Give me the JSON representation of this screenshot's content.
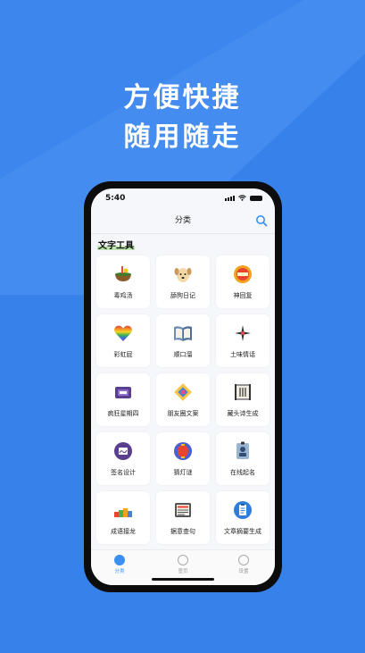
{
  "promo": {
    "line1": "方便快捷",
    "line2": "随用随走"
  },
  "status_bar": {
    "time": "5:40"
  },
  "nav": {
    "title": "分类",
    "search_icon": "search-icon"
  },
  "section": {
    "title": "文字工具"
  },
  "tools": [
    {
      "label": "毒鸡汤",
      "icon": "soup-bowl-icon"
    },
    {
      "label": "舔狗日记",
      "icon": "dog-icon"
    },
    {
      "label": "神回复",
      "icon": "wow-badge-icon"
    },
    {
      "label": "彩虹屁",
      "icon": "rainbow-heart-icon"
    },
    {
      "label": "顺口溜",
      "icon": "open-book-icon"
    },
    {
      "label": "土味情话",
      "icon": "sparkle-icon"
    },
    {
      "label": "疯狂星期四",
      "icon": "tv-icon"
    },
    {
      "label": "朋友圈文案",
      "icon": "photo-collage-icon"
    },
    {
      "label": "藏头诗生成",
      "icon": "scroll-icon"
    },
    {
      "label": "签名设计",
      "icon": "signature-icon"
    },
    {
      "label": "猜灯谜",
      "icon": "lantern-icon"
    },
    {
      "label": "在线起名",
      "icon": "id-badge-icon"
    },
    {
      "label": "成语接龙",
      "icon": "dominoes-icon"
    },
    {
      "label": "据意查句",
      "icon": "news-icon"
    },
    {
      "label": "文章摘要生成",
      "icon": "clipboard-icon"
    }
  ],
  "tabbar": [
    {
      "label": "分类",
      "active": true
    },
    {
      "label": "壹页",
      "active": false
    },
    {
      "label": "设置",
      "active": false
    }
  ],
  "colors": {
    "background": "#3c86ee",
    "accent": "#3b8ff0",
    "section_highlight": "#bde6b0"
  }
}
